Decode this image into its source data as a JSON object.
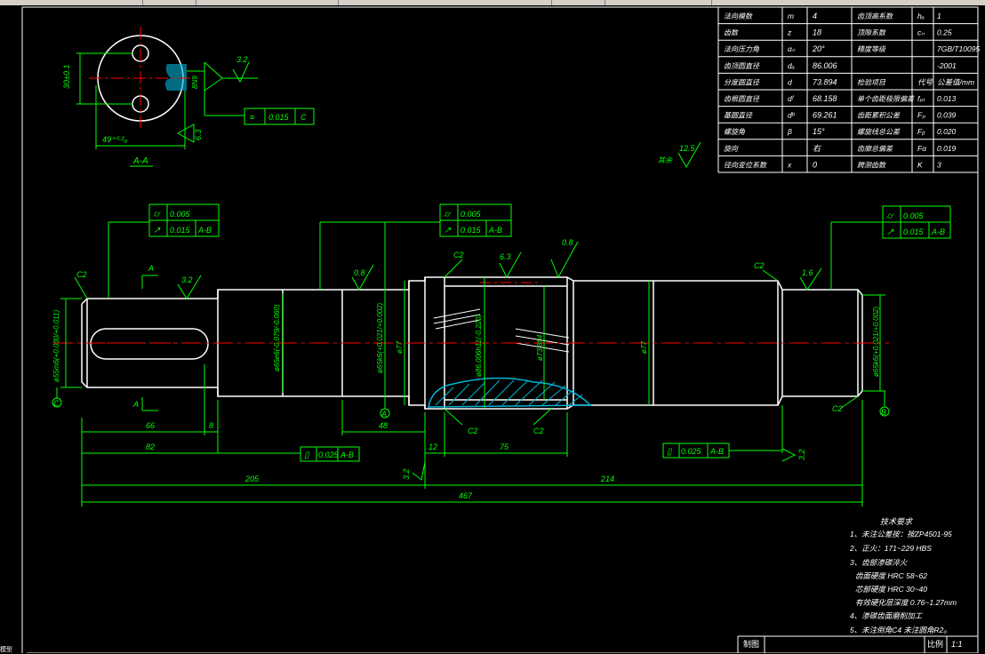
{
  "window": {
    "toolbar_segments": 6,
    "bottom_label": "模型"
  },
  "colors": {
    "background": "#000000",
    "geometry": "#ffffff",
    "dimension": "#00ff00",
    "centerline": "#ff0000",
    "hatch": "#00b4d8"
  },
  "param_table": {
    "rows": [
      {
        "name": "法向模数",
        "sym": "m",
        "val": "4",
        "name2": "齿顶高系数",
        "sym2": "hₐ",
        "val2": "1"
      },
      {
        "name": "齿数",
        "sym": "z",
        "val": "18",
        "name2": "顶隙系数",
        "sym2": "cₙ",
        "val2": "0.25"
      },
      {
        "name": "法向压力角",
        "sym": "αₙ",
        "val": "20°",
        "name2": "精度等级",
        "sym2": "",
        "val2": "7GB/T10095"
      },
      {
        "name": "齿顶圆直径",
        "sym": "dₐ",
        "val": "86.006",
        "name2": "",
        "sym2": "",
        "val2": "-2001"
      },
      {
        "name": "分度圆直径",
        "sym": "d",
        "val": "73.894",
        "name2": "检验项目",
        "sym2": "代号",
        "val2": "公差值/mm"
      },
      {
        "name": "齿根圆直径",
        "sym": "dᶠ",
        "val": "68.158",
        "name2": "单个齿距极限偏差",
        "sym2": "fₚₜ",
        "val2": "0.013"
      },
      {
        "name": "基圆直径",
        "sym": "dᵇ",
        "val": "69.261",
        "name2": "齿距累积公差",
        "sym2": "Fₚ",
        "val2": "0.039"
      },
      {
        "name": "螺旋角",
        "sym": "β",
        "val": "15°",
        "name2": "螺旋线总公差",
        "sym2": "Fᵦ",
        "val2": "0.020"
      },
      {
        "name": "旋向",
        "sym": "",
        "val": "右",
        "name2": "齿廓总偏差",
        "sym2": "Fα",
        "val2": "0.019"
      },
      {
        "name": "径向变位系数",
        "sym": "x",
        "val": "0",
        "name2": "跨测齿数",
        "sym2": "K",
        "val2": "3"
      }
    ]
  },
  "section_view": {
    "title": "A-A",
    "dims": {
      "height": "30±0.1",
      "width": "49⁺⁰·²₀",
      "slot": "8N9"
    },
    "roughness": [
      "3.2",
      "6.3"
    ],
    "tolerance": {
      "symbol": "≡",
      "value": "0.015",
      "datum": "C"
    }
  },
  "main_view": {
    "chamfers": [
      "C2",
      "C2",
      "C2",
      "C2",
      "C2",
      "C2"
    ],
    "roughness": [
      "3.2",
      "0.8",
      "6.3",
      "0.8",
      "1.6",
      "3.2",
      "3.2"
    ],
    "section_marks": [
      "A",
      "A"
    ],
    "datums": [
      "C",
      "A",
      "B"
    ],
    "diameters": [
      "ø55m6(+0.030/+0.011)",
      "ø65e6(-0.079/-0.060)",
      "ø65k6(+0.021/+0.002)",
      "ø77",
      "ø86.006h11(-0.220)",
      "ø73.894",
      "ø77",
      "ø65k6(+0.021/+0.002)"
    ],
    "lengths": [
      "66",
      "8",
      "82",
      "48",
      "12",
      "75",
      "205",
      "214",
      "467"
    ],
    "tol_frames": [
      {
        "rows": [
          {
            "sym": "⌭",
            "val": "0.005",
            "datum": ""
          },
          {
            "sym": "↗",
            "val": "0.015",
            "datum": "A-B"
          }
        ]
      },
      {
        "rows": [
          {
            "sym": "⌭",
            "val": "0.005",
            "datum": ""
          },
          {
            "sym": "↗",
            "val": "0.015",
            "datum": "A-B"
          }
        ]
      },
      {
        "rows": [
          {
            "sym": "⌭",
            "val": "0.005",
            "datum": ""
          },
          {
            "sym": "↗",
            "val": "0.015",
            "datum": "A-B"
          }
        ]
      }
    ],
    "parallel_frames": [
      {
        "sym": "▯",
        "val": "0.025",
        "datum": "A-B"
      },
      {
        "sym": "▯",
        "val": "0.025",
        "datum": "A-B"
      }
    ],
    "rest_roughness": {
      "label": "其余",
      "value": "12.5"
    }
  },
  "tech_notes": {
    "title": "技术要求",
    "lines": [
      "1、未注公差按：按ZP4501-95",
      "2、正火：171~229 HBS",
      "3、齿部渗碳淬火",
      "齿面硬度 HRC 58~62",
      "芯部硬度 HRC 30~40",
      "有效硬化层深度 0.76~1.27mm",
      "4、渗碳齿面磨削加工",
      "5、未注倒角C4 未注圆角R2₀"
    ]
  },
  "title_block": {
    "cell1": "制图",
    "cell2": "比例",
    "scale": "1:1"
  }
}
